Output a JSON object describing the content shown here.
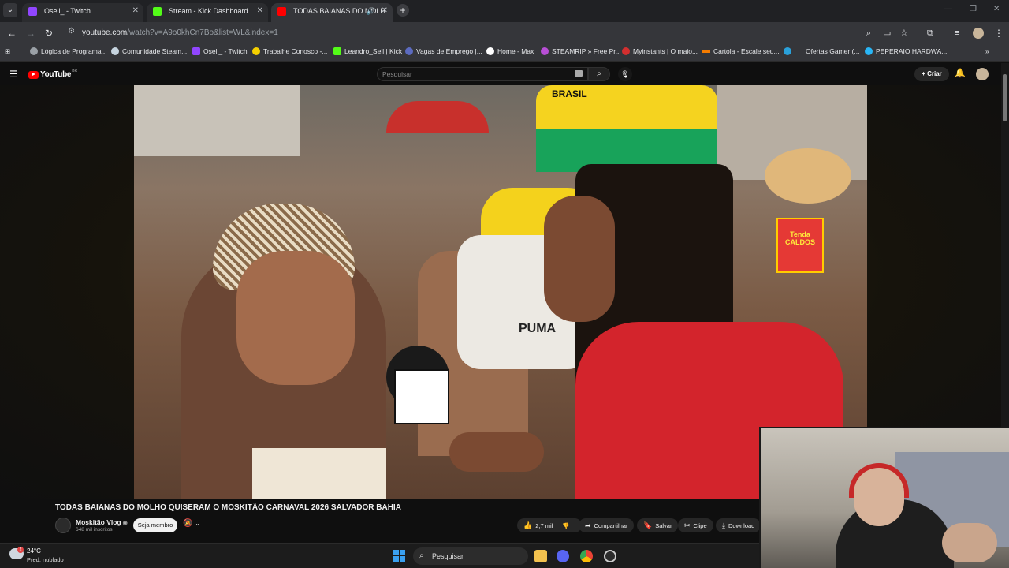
{
  "browser": {
    "tabs": [
      {
        "title": "Osell_ - Twitch",
        "favicon_color": "#9146ff",
        "active": false
      },
      {
        "title": "Stream - Kick Dashboard",
        "favicon_color": "#53fc18",
        "active": false
      },
      {
        "title": "TODAS BAIANAS DO MOLH",
        "favicon_color": "#ff0000",
        "active": true
      }
    ],
    "url_host": "youtube.com",
    "url_path": "/watch?v=A9o0khCn7Bo&list=WL&index=1",
    "bookmarks": [
      {
        "label": "Lógica de Programa...",
        "color": "#e8eaed"
      },
      {
        "label": "Comunidade Steam...",
        "color": "#1b2838"
      },
      {
        "label": "Osell_ - Twitch",
        "color": "#9146ff"
      },
      {
        "label": "Trabalhe Conosco -...",
        "color": "#f5d000"
      },
      {
        "label": "Leandro_Sell | Kick",
        "color": "#53fc18"
      },
      {
        "label": "Vagas de Emprego |...",
        "color": "#5c6bc0"
      },
      {
        "label": "Home - Max",
        "color": "#ffffff"
      },
      {
        "label": "STEAMRIP » Free Pr...",
        "color": "#b84fd6"
      },
      {
        "label": "Myinstants | O maio...",
        "color": "#d32f2f"
      },
      {
        "label": "Cartola - Escale seu...",
        "color": "#f57c00"
      },
      {
        "label": "Ofertas Gamer (...",
        "color": "#2aa1da"
      },
      {
        "label": "PEPERAIO HARDWA...",
        "color": "#29b6f6"
      }
    ]
  },
  "youtube": {
    "logo_text": "YouTube",
    "country_code": "BR",
    "search_placeholder": "Pesquisar",
    "create_label": "Criar",
    "video_title": "TODAS BAIANAS DO MOLHO QUISERAM O MOSKITÃO CARNAVAL 2026 SALVADOR BAHIA",
    "channel_name": "Moskitão Vlog",
    "channel_subs": "648 mil inscritos",
    "join_label": "Seja membro",
    "likes": "2,7 mil",
    "share_label": "Compartilhar",
    "save_label": "Salvar",
    "clip_label": "Clipe",
    "download_label": "Download",
    "video_overlay_text": {
      "cap_text": "BRASIL",
      "sign_top": "Tenda",
      "sign_bottom": "CALDOS",
      "shirt_text": "PUMA"
    }
  },
  "taskbar": {
    "weather_temp": "24°C",
    "weather_desc": "Pred. nublado",
    "weather_badge": "2",
    "search_label": "Pesquisar"
  },
  "colors": {
    "youtube_red": "#ff0000",
    "chrome_dark": "#35363a",
    "yt_background": "#0f0f0f"
  }
}
